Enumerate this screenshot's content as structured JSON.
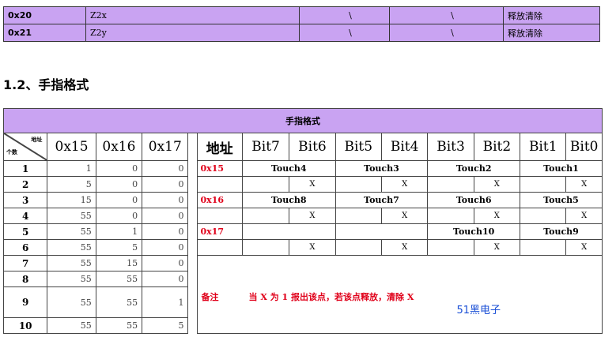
{
  "register_rows": [
    {
      "addr": "0x20",
      "name": "Z2x",
      "col3": "\\",
      "col4": "\\",
      "action": "释放清除"
    },
    {
      "addr": "0x21",
      "name": "Z2y",
      "col3": "\\",
      "col4": "\\",
      "action": "释放清除"
    }
  ],
  "section_title": "1.2、手指格式",
  "finger_table": {
    "banner": "手指格式",
    "corner_top": "地址",
    "corner_bottom": "个数",
    "col_headers": [
      "0x15",
      "0x16",
      "0x17"
    ],
    "addr_header": "地址",
    "bit_headers": [
      "Bit7",
      "Bit6",
      "Bit5",
      "Bit4",
      "Bit3",
      "Bit2",
      "Bit1",
      "Bit0"
    ],
    "count_rows": [
      {
        "n": "1",
        "v": [
          "1",
          "0",
          "0"
        ]
      },
      {
        "n": "2",
        "v": [
          "5",
          "0",
          "0"
        ]
      },
      {
        "n": "3",
        "v": [
          "15",
          "0",
          "0"
        ]
      },
      {
        "n": "4",
        "v": [
          "55",
          "0",
          "0"
        ]
      },
      {
        "n": "5",
        "v": [
          "55",
          "1",
          "0"
        ]
      },
      {
        "n": "6",
        "v": [
          "55",
          "5",
          "0"
        ]
      },
      {
        "n": "7",
        "v": [
          "55",
          "15",
          "0"
        ]
      },
      {
        "n": "8",
        "v": [
          "55",
          "55",
          "0"
        ]
      },
      {
        "n": "9",
        "v": [
          "55",
          "55",
          "1"
        ]
      },
      {
        "n": "10",
        "v": [
          "55",
          "55",
          "5"
        ]
      }
    ],
    "bit_rows": [
      {
        "reg": "0x15",
        "touch": [
          "Touch4",
          "Touch3",
          "Touch2",
          "Touch1"
        ]
      },
      {
        "reg": "0x16",
        "touch": [
          "Touch8",
          "Touch7",
          "Touch6",
          "Touch5"
        ]
      },
      {
        "reg": "0x17",
        "touch": [
          "",
          "",
          "Touch10",
          "Touch9"
        ]
      }
    ],
    "x_mark": "X",
    "note_label": "备注",
    "note_text": "当 X 为 1 报出该点，若该点释放，清除 X",
    "watermark": "51黑电子"
  }
}
